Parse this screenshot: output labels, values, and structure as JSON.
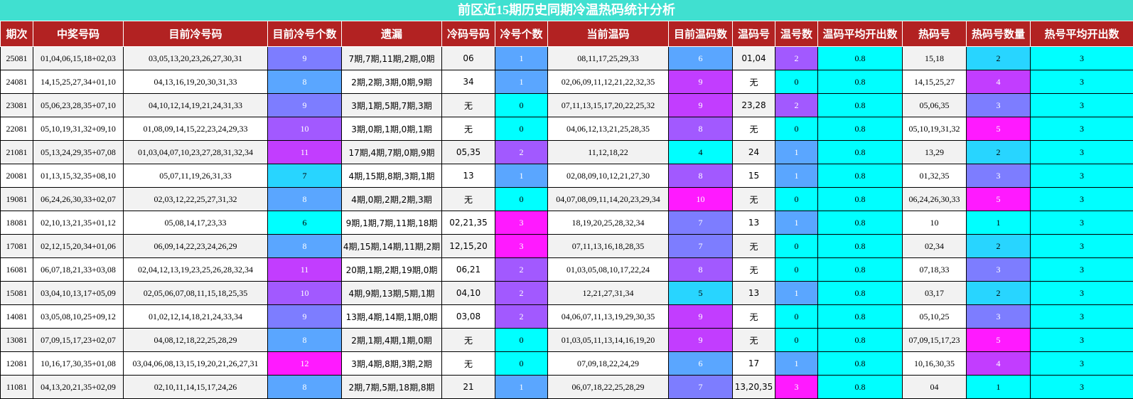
{
  "title": "前区近15期历史同期冷温热码统计分析",
  "headers": [
    "期次",
    "中奖号码",
    "目前冷号码",
    "目前冷号个数",
    "遗漏",
    "冷码号码",
    "冷号个数",
    "当前温码",
    "目前温码数",
    "温码号",
    "温号数",
    "温码平均开出数",
    "热码号",
    "热码号数量",
    "热号平均开出数"
  ],
  "colors": {
    "title_bg": "#40e0d0",
    "header_bg": "#b22222",
    "cyan": "#00ffff",
    "sky": "#28d5ff",
    "blue": "#5aa6ff",
    "periwinkle": "#7d7dff",
    "violet": "#a259ff",
    "purple": "#c23dff",
    "magenta": "#ff1aff",
    "row_odd": "#f2f2f2",
    "row_even": "#ffffff"
  },
  "rows": [
    {
      "issue": "25081",
      "win": "01,04,06,15,18+02,03",
      "cold": "03,05,13,20,23,26,27,30,31",
      "cold_cnt": "9",
      "miss": "7期,7期,11期,2期,0期",
      "cold_code": "06",
      "cold_num": "1",
      "warm": "08,11,17,25,29,33",
      "warm_cnt": "6",
      "warm_code": "01,04",
      "warm_num": "2",
      "warm_avg": "0.8",
      "hot": "15,18",
      "hot_cnt": "2",
      "hot_avg": "3"
    },
    {
      "issue": "24081",
      "win": "14,15,25,27,34+01,10",
      "cold": "04,13,16,19,20,30,31,33",
      "cold_cnt": "8",
      "miss": "2期,2期,3期,0期,9期",
      "cold_code": "34",
      "cold_num": "1",
      "warm": "02,06,09,11,12,21,22,32,35",
      "warm_cnt": "9",
      "warm_code": "无",
      "warm_num": "0",
      "warm_avg": "0.8",
      "hot": "14,15,25,27",
      "hot_cnt": "4",
      "hot_avg": "3"
    },
    {
      "issue": "23081",
      "win": "05,06,23,28,35+07,10",
      "cold": "04,10,12,14,19,21,24,31,33",
      "cold_cnt": "9",
      "miss": "3期,1期,5期,7期,3期",
      "cold_code": "无",
      "cold_num": "0",
      "warm": "07,11,13,15,17,20,22,25,32",
      "warm_cnt": "9",
      "warm_code": "23,28",
      "warm_num": "2",
      "warm_avg": "0.8",
      "hot": "05,06,35",
      "hot_cnt": "3",
      "hot_avg": "3"
    },
    {
      "issue": "22081",
      "win": "05,10,19,31,32+09,10",
      "cold": "01,08,09,14,15,22,23,24,29,33",
      "cold_cnt": "10",
      "miss": "3期,0期,1期,0期,1期",
      "cold_code": "无",
      "cold_num": "0",
      "warm": "04,06,12,13,21,25,28,35",
      "warm_cnt": "8",
      "warm_code": "无",
      "warm_num": "0",
      "warm_avg": "0.8",
      "hot": "05,10,19,31,32",
      "hot_cnt": "5",
      "hot_avg": "3"
    },
    {
      "issue": "21081",
      "win": "05,13,24,29,35+07,08",
      "cold": "01,03,04,07,10,23,27,28,31,32,34",
      "cold_cnt": "11",
      "miss": "17期,4期,7期,0期,9期",
      "cold_code": "05,35",
      "cold_num": "2",
      "warm": "11,12,18,22",
      "warm_cnt": "4",
      "warm_code": "24",
      "warm_num": "1",
      "warm_avg": "0.8",
      "hot": "13,29",
      "hot_cnt": "2",
      "hot_avg": "3"
    },
    {
      "issue": "20081",
      "win": "01,13,15,32,35+08,10",
      "cold": "05,07,11,19,26,31,33",
      "cold_cnt": "7",
      "miss": "4期,15期,8期,3期,1期",
      "cold_code": "13",
      "cold_num": "1",
      "warm": "02,08,09,10,12,21,27,30",
      "warm_cnt": "8",
      "warm_code": "15",
      "warm_num": "1",
      "warm_avg": "0.8",
      "hot": "01,32,35",
      "hot_cnt": "3",
      "hot_avg": "3"
    },
    {
      "issue": "19081",
      "win": "06,24,26,30,33+02,07",
      "cold": "02,03,12,22,25,27,31,32",
      "cold_cnt": "8",
      "miss": "4期,0期,2期,2期,3期",
      "cold_code": "无",
      "cold_num": "0",
      "warm": "04,07,08,09,11,14,20,23,29,34",
      "warm_cnt": "10",
      "warm_code": "无",
      "warm_num": "0",
      "warm_avg": "0.8",
      "hot": "06,24,26,30,33",
      "hot_cnt": "5",
      "hot_avg": "3"
    },
    {
      "issue": "18081",
      "win": "02,10,13,21,35+01,12",
      "cold": "05,08,14,17,23,33",
      "cold_cnt": "6",
      "miss": "9期,1期,7期,11期,18期",
      "cold_code": "02,21,35",
      "cold_num": "3",
      "warm": "18,19,20,25,28,32,34",
      "warm_cnt": "7",
      "warm_code": "13",
      "warm_num": "1",
      "warm_avg": "0.8",
      "hot": "10",
      "hot_cnt": "1",
      "hot_avg": "3"
    },
    {
      "issue": "17081",
      "win": "02,12,15,20,34+01,06",
      "cold": "06,09,14,22,23,24,26,29",
      "cold_cnt": "8",
      "miss": "4期,15期,14期,11期,2期",
      "cold_code": "12,15,20",
      "cold_num": "3",
      "warm": "07,11,13,16,18,28,35",
      "warm_cnt": "7",
      "warm_code": "无",
      "warm_num": "0",
      "warm_avg": "0.8",
      "hot": "02,34",
      "hot_cnt": "2",
      "hot_avg": "3"
    },
    {
      "issue": "16081",
      "win": "06,07,18,21,33+03,08",
      "cold": "02,04,12,13,19,23,25,26,28,32,34",
      "cold_cnt": "11",
      "miss": "20期,1期,2期,19期,0期",
      "cold_code": "06,21",
      "cold_num": "2",
      "warm": "01,03,05,08,10,17,22,24",
      "warm_cnt": "8",
      "warm_code": "无",
      "warm_num": "0",
      "warm_avg": "0.8",
      "hot": "07,18,33",
      "hot_cnt": "3",
      "hot_avg": "3"
    },
    {
      "issue": "15081",
      "win": "03,04,10,13,17+05,09",
      "cold": "02,05,06,07,08,11,15,18,25,35",
      "cold_cnt": "10",
      "miss": "4期,9期,13期,5期,1期",
      "cold_code": "04,10",
      "cold_num": "2",
      "warm": "12,21,27,31,34",
      "warm_cnt": "5",
      "warm_code": "13",
      "warm_num": "1",
      "warm_avg": "0.8",
      "hot": "03,17",
      "hot_cnt": "2",
      "hot_avg": "3"
    },
    {
      "issue": "14081",
      "win": "03,05,08,10,25+09,12",
      "cold": "01,02,12,14,18,21,24,33,34",
      "cold_cnt": "9",
      "miss": "13期,4期,14期,1期,0期",
      "cold_code": "03,08",
      "cold_num": "2",
      "warm": "04,06,07,11,13,19,29,30,35",
      "warm_cnt": "9",
      "warm_code": "无",
      "warm_num": "0",
      "warm_avg": "0.8",
      "hot": "05,10,25",
      "hot_cnt": "3",
      "hot_avg": "3"
    },
    {
      "issue": "13081",
      "win": "07,09,15,17,23+02,07",
      "cold": "04,08,12,18,22,25,28,29",
      "cold_cnt": "8",
      "miss": "2期,1期,4期,1期,0期",
      "cold_code": "无",
      "cold_num": "0",
      "warm": "01,03,05,11,13,14,16,19,20",
      "warm_cnt": "9",
      "warm_code": "无",
      "warm_num": "0",
      "warm_avg": "0.8",
      "hot": "07,09,15,17,23",
      "hot_cnt": "5",
      "hot_avg": "3"
    },
    {
      "issue": "12081",
      "win": "10,16,17,30,35+01,08",
      "cold": "03,04,06,08,13,15,19,20,21,26,27,31",
      "cold_cnt": "12",
      "miss": "3期,4期,8期,3期,2期",
      "cold_code": "无",
      "cold_num": "0",
      "warm": "07,09,18,22,24,29",
      "warm_cnt": "6",
      "warm_code": "17",
      "warm_num": "1",
      "warm_avg": "0.8",
      "hot": "10,16,30,35",
      "hot_cnt": "4",
      "hot_avg": "3"
    },
    {
      "issue": "11081",
      "win": "04,13,20,21,35+02,09",
      "cold": "02,10,11,14,15,17,24,26",
      "cold_cnt": "8",
      "miss": "2期,7期,5期,18期,8期",
      "cold_code": "21",
      "cold_num": "1",
      "warm": "06,07,18,22,25,28,29",
      "warm_cnt": "7",
      "warm_code": "13,20,35",
      "warm_num": "3",
      "warm_avg": "0.8",
      "hot": "04",
      "hot_cnt": "1",
      "hot_avg": "3"
    }
  ]
}
